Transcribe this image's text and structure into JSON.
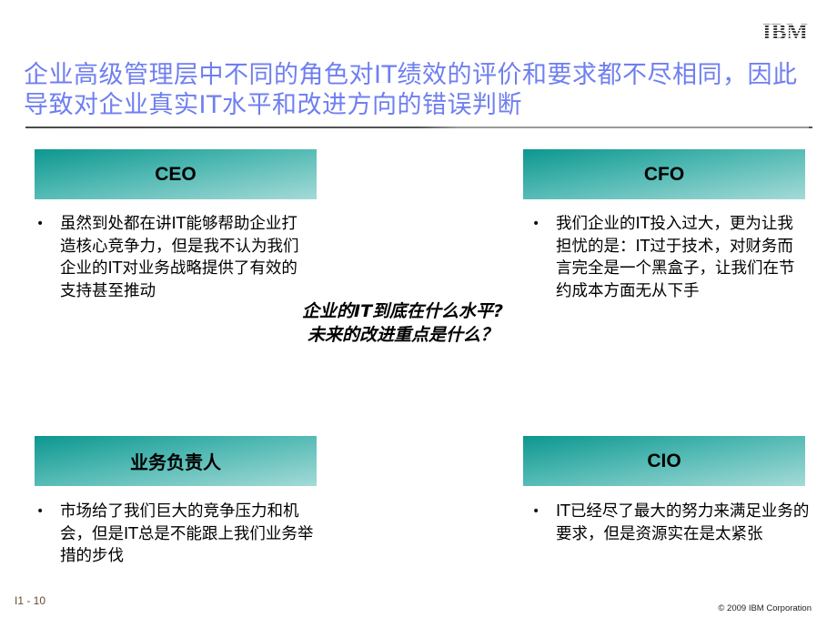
{
  "header": {
    "logo_text": "IBM",
    "title": "企业高级管理层中不同的角色对IT绩效的评价和要求都不尽相同，因此导致对企业真实IT水平和改进方向的错误判断"
  },
  "roles": [
    {
      "label": "CEO",
      "bullet": "虽然到处都在讲IT能够帮助企业打造核心竞争力，但是我不认为我们企业的IT对业务战略提供了有效的支持甚至推动"
    },
    {
      "label": "CFO",
      "bullet": "我们企业的IT投入过大，更为让我担忧的是：IT过于技术，对财务而言完全是一个黑盒子，让我们在节约成本方面无从下手"
    },
    {
      "label": "业务负责人",
      "bullet": "市场给了我们巨大的竞争压力和机会，但是IT总是不能跟上我们业务举措的步伐"
    },
    {
      "label": "CIO",
      "bullet": "IT已经尽了最大的努力来满足业务的要求，但是资源实在是太紧张"
    }
  ],
  "center_question": {
    "line1": "企业的IT到底在什么水平?",
    "line2": "未来的改进重点是什么？"
  },
  "footer": {
    "page": "I1 - 10",
    "copyright": "© 2009 IBM Corporation"
  },
  "colors": {
    "title": "#6f7ff0",
    "box_gradient_start": "#0c978f",
    "box_gradient_end": "#a4dad7",
    "footer_page": "#6b4a2a"
  }
}
